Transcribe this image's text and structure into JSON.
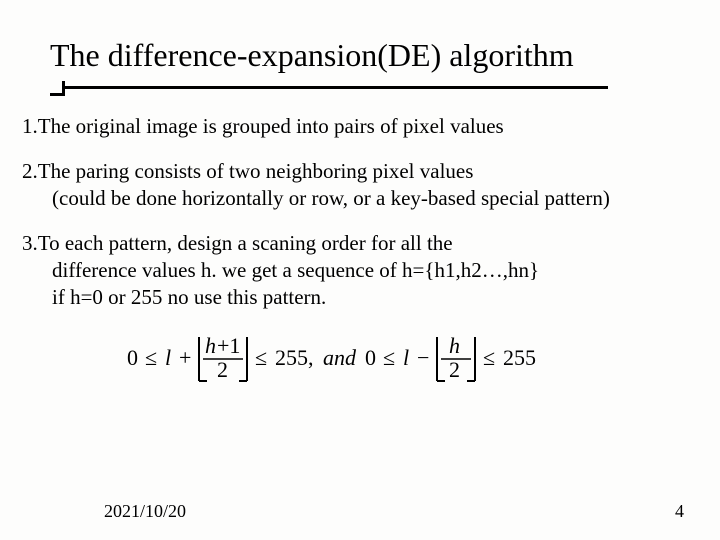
{
  "title": "The difference-expansion(DE) algorithm",
  "items": [
    {
      "lines": [
        "1.The original image is grouped into pairs of pixel values"
      ]
    },
    {
      "lines": [
        "2.The paring consists of two neighboring pixel values",
        "(could be done horizontally or row, or a key-based special pattern)"
      ]
    },
    {
      "lines": [
        "3.To each pattern, design a scaning order for all the",
        "difference values h. we get a sequence of  h={h1,h2…,hn}",
        "if h=0 or 255 no use this pattern."
      ]
    }
  ],
  "formula": {
    "tex": "0 \\le l + \\left\\lfloor \\frac{h+1}{2} \\right\\rfloor \\le 255,\\; and\\; 0 \\le l - \\left\\lfloor \\frac{h}{2} \\right\\rfloor \\le 255"
  },
  "footer": {
    "date": "2021/10/20",
    "page": "4"
  }
}
